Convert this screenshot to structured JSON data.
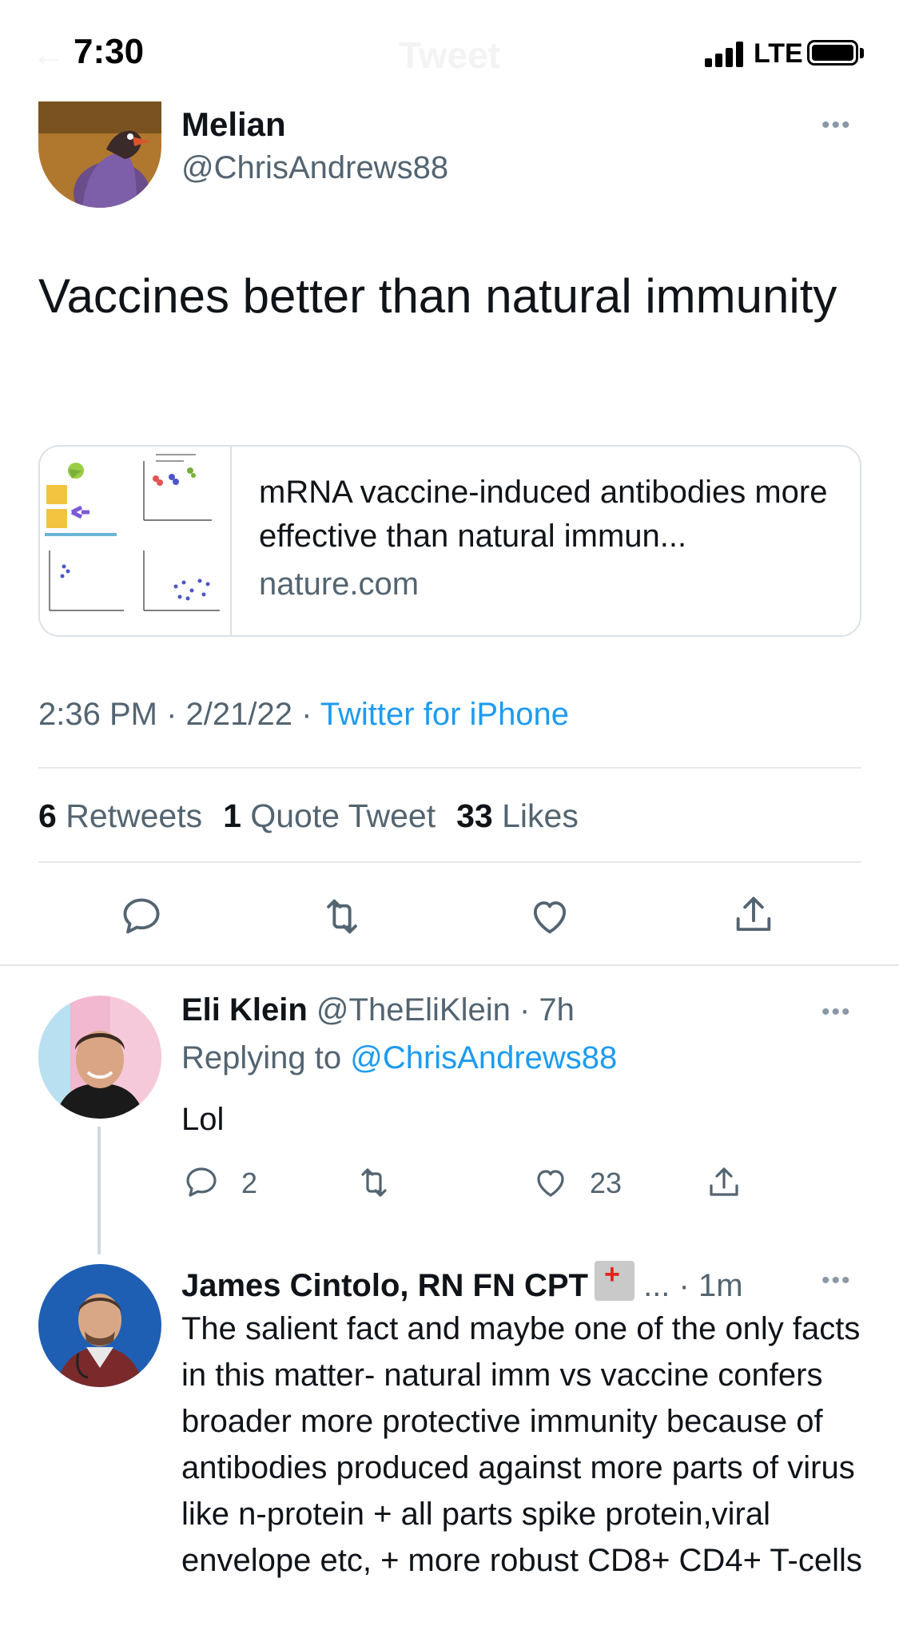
{
  "status_bar": {
    "time": "7:30",
    "network": "LTE"
  },
  "nav": {
    "title": "Tweet"
  },
  "tweet": {
    "author_name": "Melian",
    "author_handle": "@ChrisAndrews88",
    "text": "Vaccines better than natural immunity",
    "card": {
      "title": "mRNA vaccine-induced antibodies more effective than natural immun...",
      "domain": "nature.com"
    },
    "time": "2:36 PM · 2/21/22 · ",
    "source": "Twitter for iPhone",
    "stats": {
      "retweets_count": "6",
      "retweets_label": "Retweets",
      "quotes_count": "1",
      "quotes_label": "Quote Tweet",
      "likes_count": "33",
      "likes_label": "Likes"
    }
  },
  "replies": [
    {
      "name": "Eli Klein",
      "meta": " @TheEliKlein · 7h",
      "replying_prefix": "Replying to ",
      "replying_to": "@ChrisAndrews88",
      "text": "Lol",
      "reply_count": "2",
      "like_count": "23"
    },
    {
      "name": "James Cintolo, RN FN CPT",
      "meta": "... · 1m",
      "text": "The salient fact and maybe one of the only facts in this matter- natural imm vs vaccine confers broader more protective immunity because of antibodies produced against more parts of virus like n-protein + all parts spike protein,viral envelope etc, + more robust CD8+ CD4+ T-cells"
    }
  ],
  "colors": {
    "accent": "#1d9bf0",
    "secondary_text": "#536471",
    "divider": "#e5e8eb"
  },
  "icons": [
    "back-arrow-icon",
    "signal-icon",
    "battery-icon",
    "more-icon",
    "reply-icon",
    "retweet-icon",
    "like-icon",
    "share-icon",
    "hospital-emoji-icon"
  ]
}
